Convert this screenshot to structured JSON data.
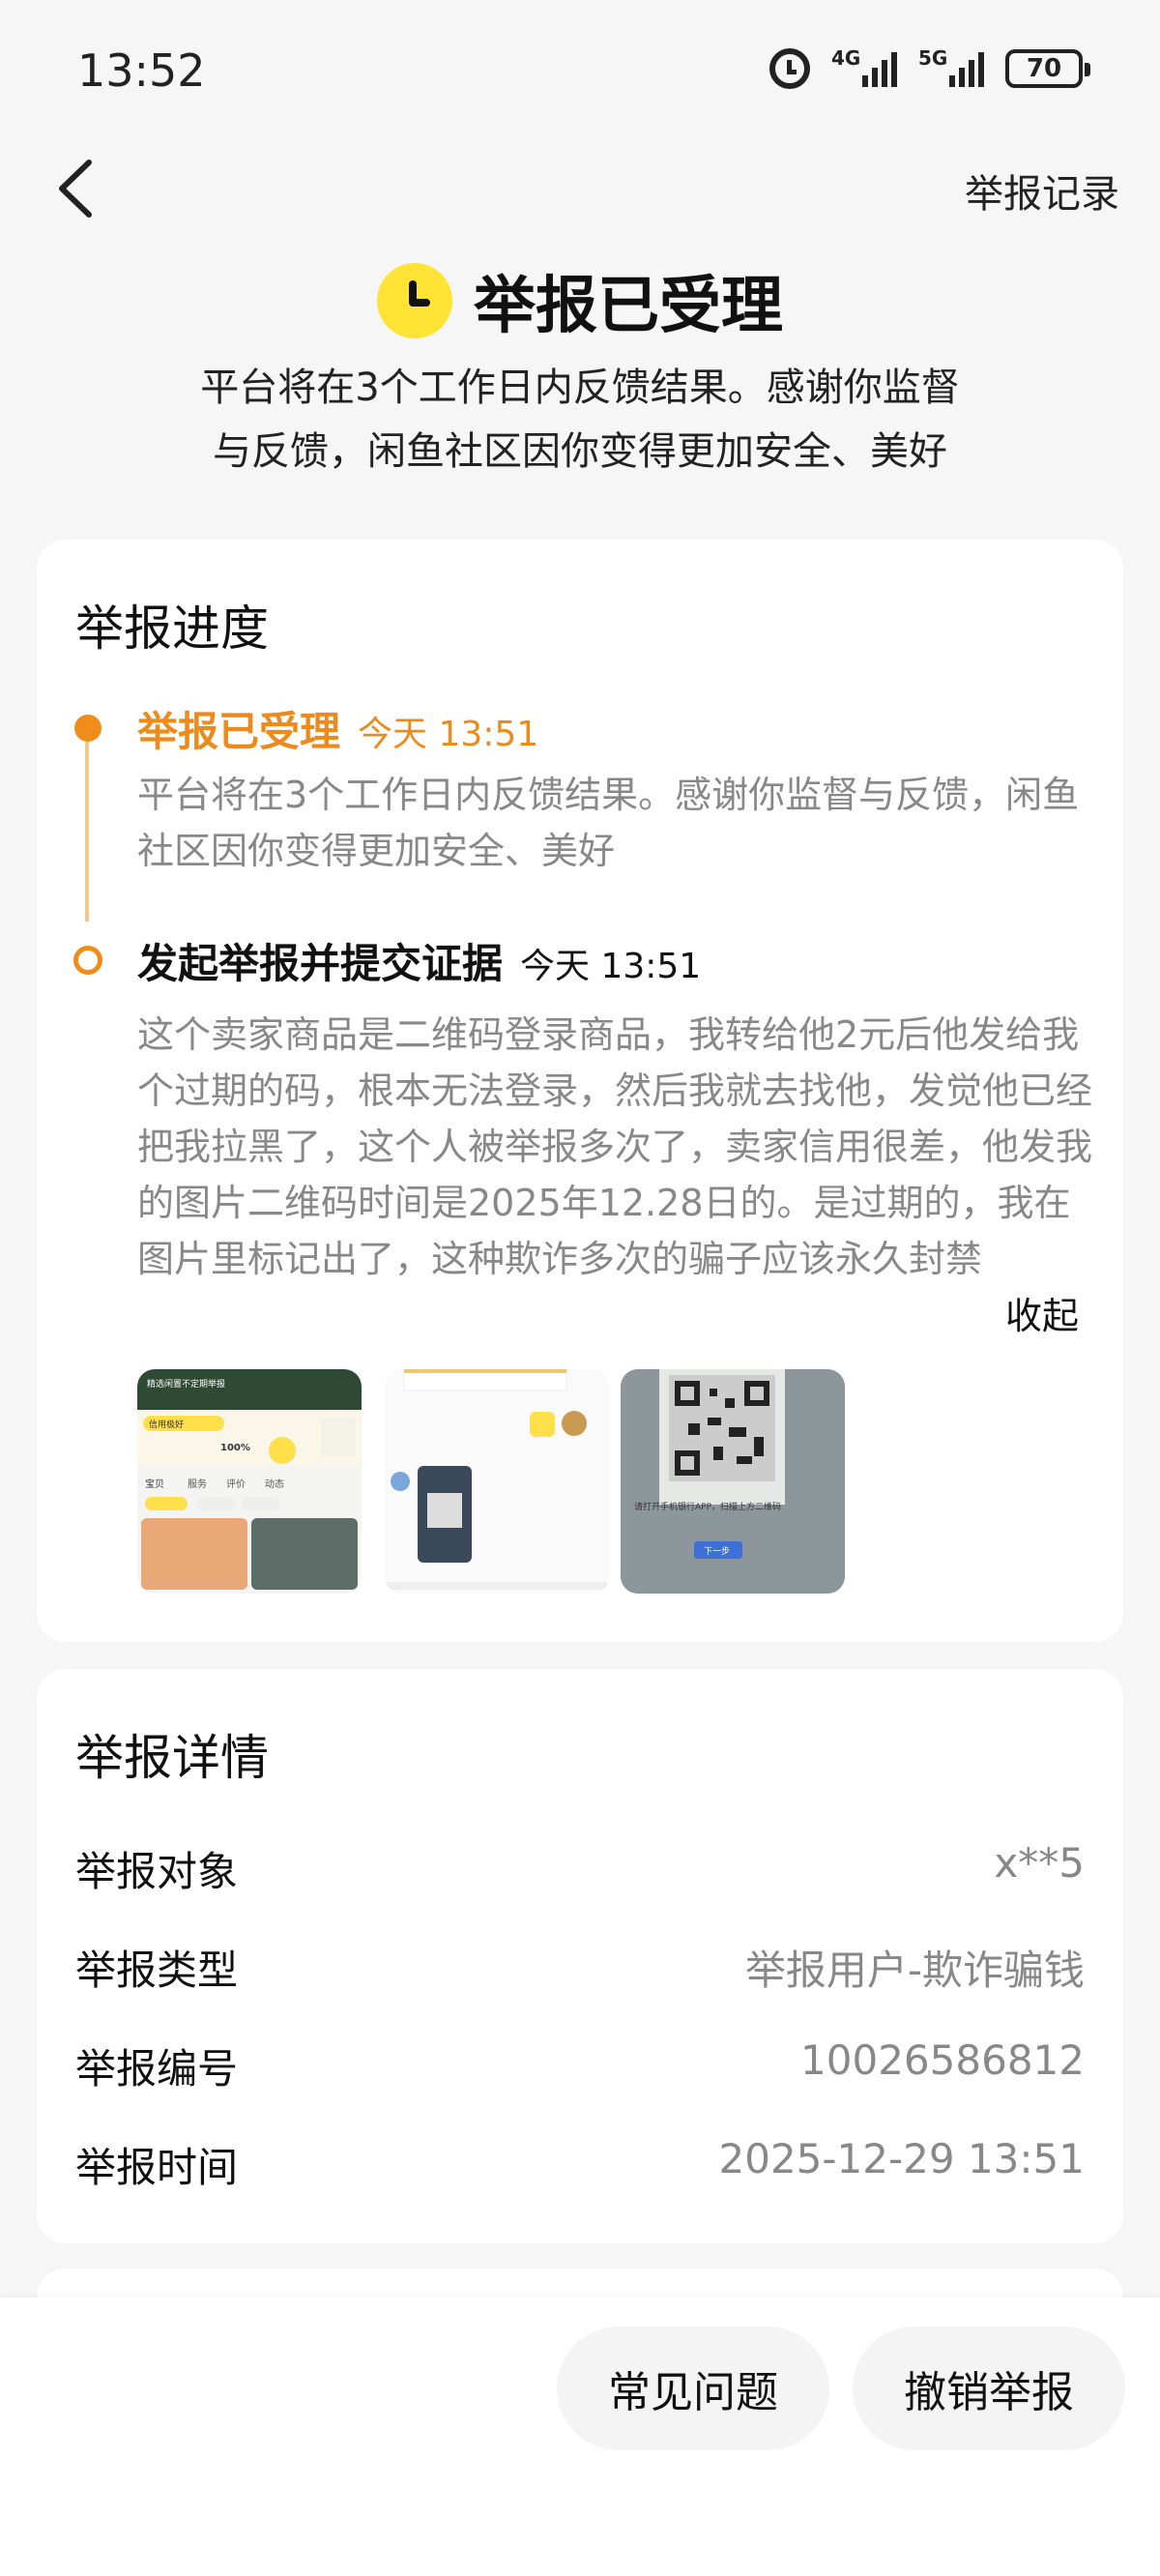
{
  "status_bar": {
    "time": "13:52",
    "network1": "4G",
    "network2": "5G",
    "battery": "70",
    "icons": [
      "alarm-icon",
      "signal-4g-icon",
      "signal-5g-icon",
      "battery-icon"
    ]
  },
  "header": {
    "records_label": "举报记录",
    "back_icon": "chevron-left-icon"
  },
  "hero": {
    "title": "举报已受理",
    "icon": "clock-icon",
    "subtitle_line1": "平台将在3个工作日内反馈结果。感谢你监督",
    "subtitle_line2": "与反馈，闲鱼社区因你变得更加安全、美好"
  },
  "progress": {
    "title": "举报进度",
    "accent_color": "#f08c1a",
    "steps": [
      {
        "title": "举报已受理",
        "time": "今天 13:51",
        "desc": "平台将在3个工作日内反馈结果。感谢你监督与反馈，闲鱼社区因你变得更加安全、美好"
      },
      {
        "title": "发起举报并提交证据",
        "time": "今天 13:51",
        "desc": "这个卖家商品是二维码登录商品，我转给他2元后他发给我个过期的码，根本无法登录，然后我就去找他，发觉他已经把我拉黑了，这个人被举报多次了，卖家信用很差，他发我的图片二维码时间是2025年12.28日的。是过期的，我在图片里标记出了，这种欺诈多次的骗子应该永久封禁"
      }
    ],
    "collapse_label": "收起",
    "evidence": {
      "img1": {
        "header": "精选闲置不定期举报",
        "tabs": [
          "宝贝",
          "服务",
          "评价",
          "动态"
        ],
        "chip1": "信用极好",
        "stat": "100%"
      },
      "img3": {
        "caption": "请打开手机银行APP，扫描上方二维码",
        "button": "下一步"
      }
    }
  },
  "details": {
    "title": "举报详情",
    "rows": [
      {
        "label": "举报对象",
        "value": "x**5"
      },
      {
        "label": "举报类型",
        "value": "举报用户-欺诈骗钱"
      },
      {
        "label": "举报编号",
        "value": "10026586812"
      },
      {
        "label": "举报时间",
        "value": "2025-12-29 13:51"
      }
    ]
  },
  "bottom_bar": {
    "faq_label": "常见问题",
    "revoke_label": "撤销举报"
  }
}
